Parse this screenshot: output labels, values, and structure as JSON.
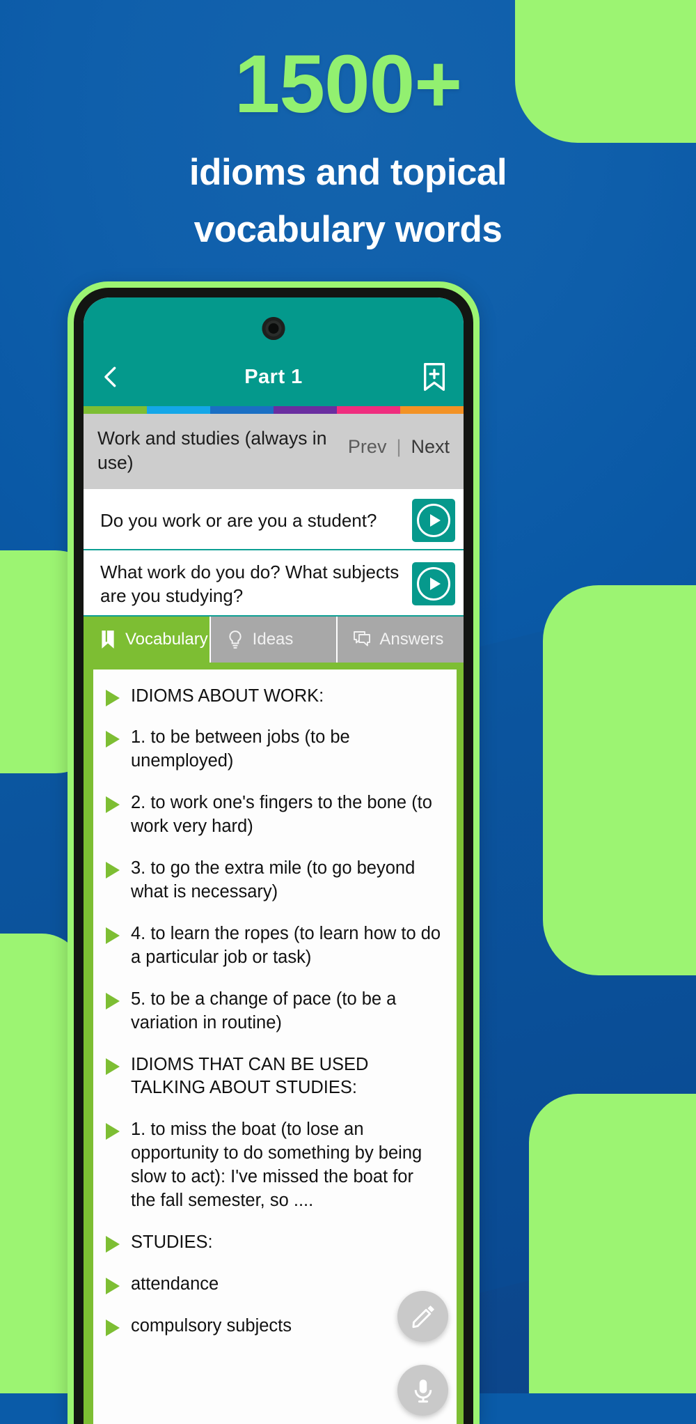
{
  "promo": {
    "headline_big": "1500+",
    "headline_line1": "idioms and topical",
    "headline_line2": "vocabulary words",
    "accent_green": "#92f070",
    "bg_blue": "#0f5fab"
  },
  "app": {
    "appbar": {
      "title": "Part  1",
      "back_icon": "chevron-left-icon",
      "bookmark_icon": "bookmark-add-icon",
      "bg_color": "#04998c"
    },
    "stripes": [
      "#7dbe33",
      "#14a7e8",
      "#1a6fc4",
      "#6a2ea0",
      "#ef2d7e",
      "#f29225"
    ],
    "topic": {
      "title": "Work and studies (always in use)",
      "prev_label": "Prev",
      "separator": "|",
      "next_label": "Next"
    },
    "questions": [
      {
        "text": "Do you work or are you a student?",
        "play_icon": "play-circle-icon"
      },
      {
        "text": "What work do you do? What subjects are you studying?",
        "play_icon": "play-circle-icon"
      }
    ],
    "tabs": [
      {
        "label": "Vocabulary",
        "icon": "book-icon",
        "active": true
      },
      {
        "label": "Ideas",
        "icon": "lightbulb-icon",
        "active": false
      },
      {
        "label": "Answers",
        "icon": "chat-bubbles-icon",
        "active": false
      }
    ],
    "vocabulary_items": [
      "IDIOMS ABOUT WORK:",
      "1. to be between jobs (to be unemployed)",
      "2. to work one's fingers to the bone (to work very hard)",
      "3. to go the extra mile (to go beyond what is necessary)",
      "4. to learn the ropes (to learn how to do a particular job or task)",
      "5. to be a change of pace (to be a variation in routine)",
      "IDIOMS THAT CAN BE USED TALKING ABOUT STUDIES:",
      "1. to miss the boat (to lose an opportunity to do something by being slow to act): I've missed the boat for the fall semester, so ....",
      "STUDIES:",
      "attendance",
      "compulsory subjects"
    ],
    "fabs": [
      {
        "name": "edit",
        "icon": "pencil-icon"
      },
      {
        "name": "record",
        "icon": "microphone-icon"
      }
    ]
  }
}
